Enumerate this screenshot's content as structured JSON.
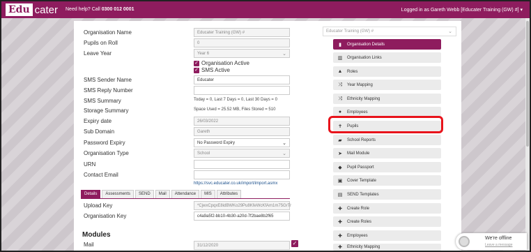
{
  "header": {
    "logo_edu": "Edu",
    "logo_cater": "cater",
    "help_text": "Need help? Call ",
    "help_phone": "0300 012 0001",
    "login_text": "Logged in as Gareth Webb [Educater Training (GW) #] ▾"
  },
  "form": {
    "org_name_label": "Organisation Name",
    "org_name_value": "Educater Training (GW) #",
    "pupils_label": "Pupils on Roll",
    "pupils_value": "0",
    "leave_year_label": "Leave Year",
    "leave_year_value": "Year 6",
    "org_active_label": "Organisation Active",
    "sms_active_label": "SMS Active",
    "sms_sender_label": "SMS Sender Name",
    "sms_sender_value": "Educater",
    "sms_reply_label": "SMS Reply Number",
    "sms_reply_value": "",
    "sms_summary_label": "SMS Summary",
    "sms_summary_value": "Today = 0, Last 7 Days = 0, Last 30 Days = 0",
    "storage_label": "Storage Summary",
    "storage_value": "Space Used = 25.52 MB, Files Stored = 510",
    "expiry_label": "Expiry date",
    "expiry_value": "26/03/2022",
    "subdomain_label": "Sub Domain",
    "subdomain_value": "Gareth",
    "pwd_expiry_label": "Password Expiry",
    "pwd_expiry_value": "No Password Expiry",
    "org_type_label": "Organisation Type",
    "org_type_value": "School",
    "urn_label": "URN",
    "urn_value": "",
    "contact_label": "Contact Email",
    "contact_value": "",
    "import_link": "https://svc.educater.co.uk/import/import.asmx",
    "upload_key_label": "Upload Key",
    "upload_key_value": "*CjwxCpqxE8idBWKo29Pu8KfeWcKfAm1m75GrTr",
    "org_key_label": "Organisation Key",
    "org_key_value": "c4a9a5f2-bb10-4b30-a20d-7f2bae8b2f65",
    "modules_heading": "Modules",
    "mail_label": "Mail",
    "mail_value": "31/12/2020"
  },
  "tabs": [
    "Details",
    "Assessments",
    "SEND",
    "Mail",
    "Attendance",
    "MIS",
    "Attributes"
  ],
  "right": {
    "org_select": "Educater Training (GW) #",
    "nav": [
      {
        "label": "Organisation Details",
        "icon": "file-icon",
        "glyph": "▮"
      },
      {
        "label": "Organisation Links",
        "icon": "institution-icon",
        "glyph": "▥"
      },
      {
        "label": "Roles",
        "icon": "lock-icon",
        "glyph": "▲"
      },
      {
        "label": "Year Mapping",
        "icon": "shuffle-icon",
        "glyph": "⤨"
      },
      {
        "label": "Ethnicity Mapping",
        "icon": "shuffle-icon",
        "glyph": "⤨"
      },
      {
        "label": "Employees",
        "icon": "user-icon",
        "glyph": "●"
      },
      {
        "label": "Pupils",
        "icon": "child-icon",
        "glyph": "✝"
      },
      {
        "label": "School Reports",
        "icon": "book-icon",
        "glyph": "▰"
      },
      {
        "label": "Mail Module",
        "icon": "send-icon",
        "glyph": "➤"
      },
      {
        "label": "Pupil Passport",
        "icon": "chat-icon",
        "glyph": "◆"
      },
      {
        "label": "Cover Template",
        "icon": "image-icon",
        "glyph": "▣"
      },
      {
        "label": "SEND Templates",
        "icon": "document-icon",
        "glyph": "▤"
      },
      {
        "label": "Create Role",
        "icon": "plus-circle-icon",
        "glyph": "✚"
      },
      {
        "label": "Create Roles",
        "icon": "plus-circle-icon",
        "glyph": "✚"
      },
      {
        "label": "Employees",
        "icon": "plus-circle-icon",
        "glyph": "✚"
      },
      {
        "label": "Ethnicity Mapping",
        "icon": "plus-circle-icon",
        "glyph": "✚"
      }
    ]
  },
  "chat": {
    "status": "We're offline",
    "action": "Leave a message"
  },
  "colors": {
    "brand": "#8e1c5e",
    "highlight": "#e8131b"
  }
}
